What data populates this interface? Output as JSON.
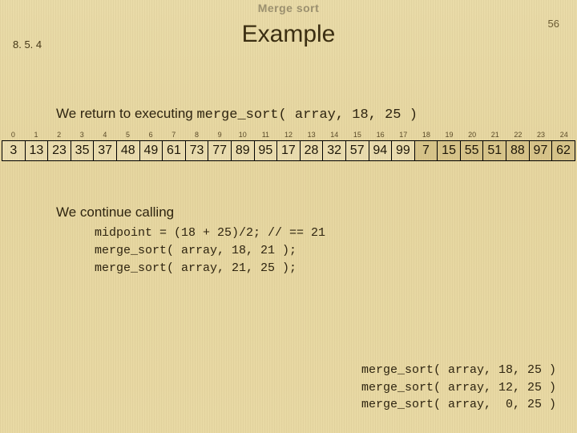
{
  "header": {
    "top_label": "Merge sort",
    "page_number": "56",
    "section": "8. 5. 4",
    "title": "Example"
  },
  "body": {
    "line1_prefix": "We return to executing ",
    "line1_code": "merge_sort( array, 18, 25 )",
    "line2": "We continue calling"
  },
  "code": {
    "l1": "midpoint = (18 + 25)/2; // == 21",
    "l2": "merge_sort( array, 18, 21 );",
    "l3": "merge_sort( array, 21, 25 );"
  },
  "stack": {
    "s1": "merge_sort( array, 18, 25 )",
    "s2": "merge_sort( array, 12, 25 )",
    "s3": "merge_sort( array,  0, 25 )"
  },
  "array": {
    "indices": [
      "0",
      "1",
      "2",
      "3",
      "4",
      "5",
      "6",
      "7",
      "8",
      "9",
      "10",
      "11",
      "12",
      "13",
      "14",
      "15",
      "16",
      "17",
      "18",
      "19",
      "20",
      "21",
      "22",
      "23",
      "24"
    ],
    "values": [
      "3",
      "13",
      "23",
      "35",
      "37",
      "48",
      "49",
      "61",
      "73",
      "77",
      "89",
      "95",
      "17",
      "28",
      "32",
      "57",
      "94",
      "99",
      "7",
      "15",
      "55",
      "51",
      "88",
      "97",
      "62"
    ],
    "unsorted_start": 18
  }
}
